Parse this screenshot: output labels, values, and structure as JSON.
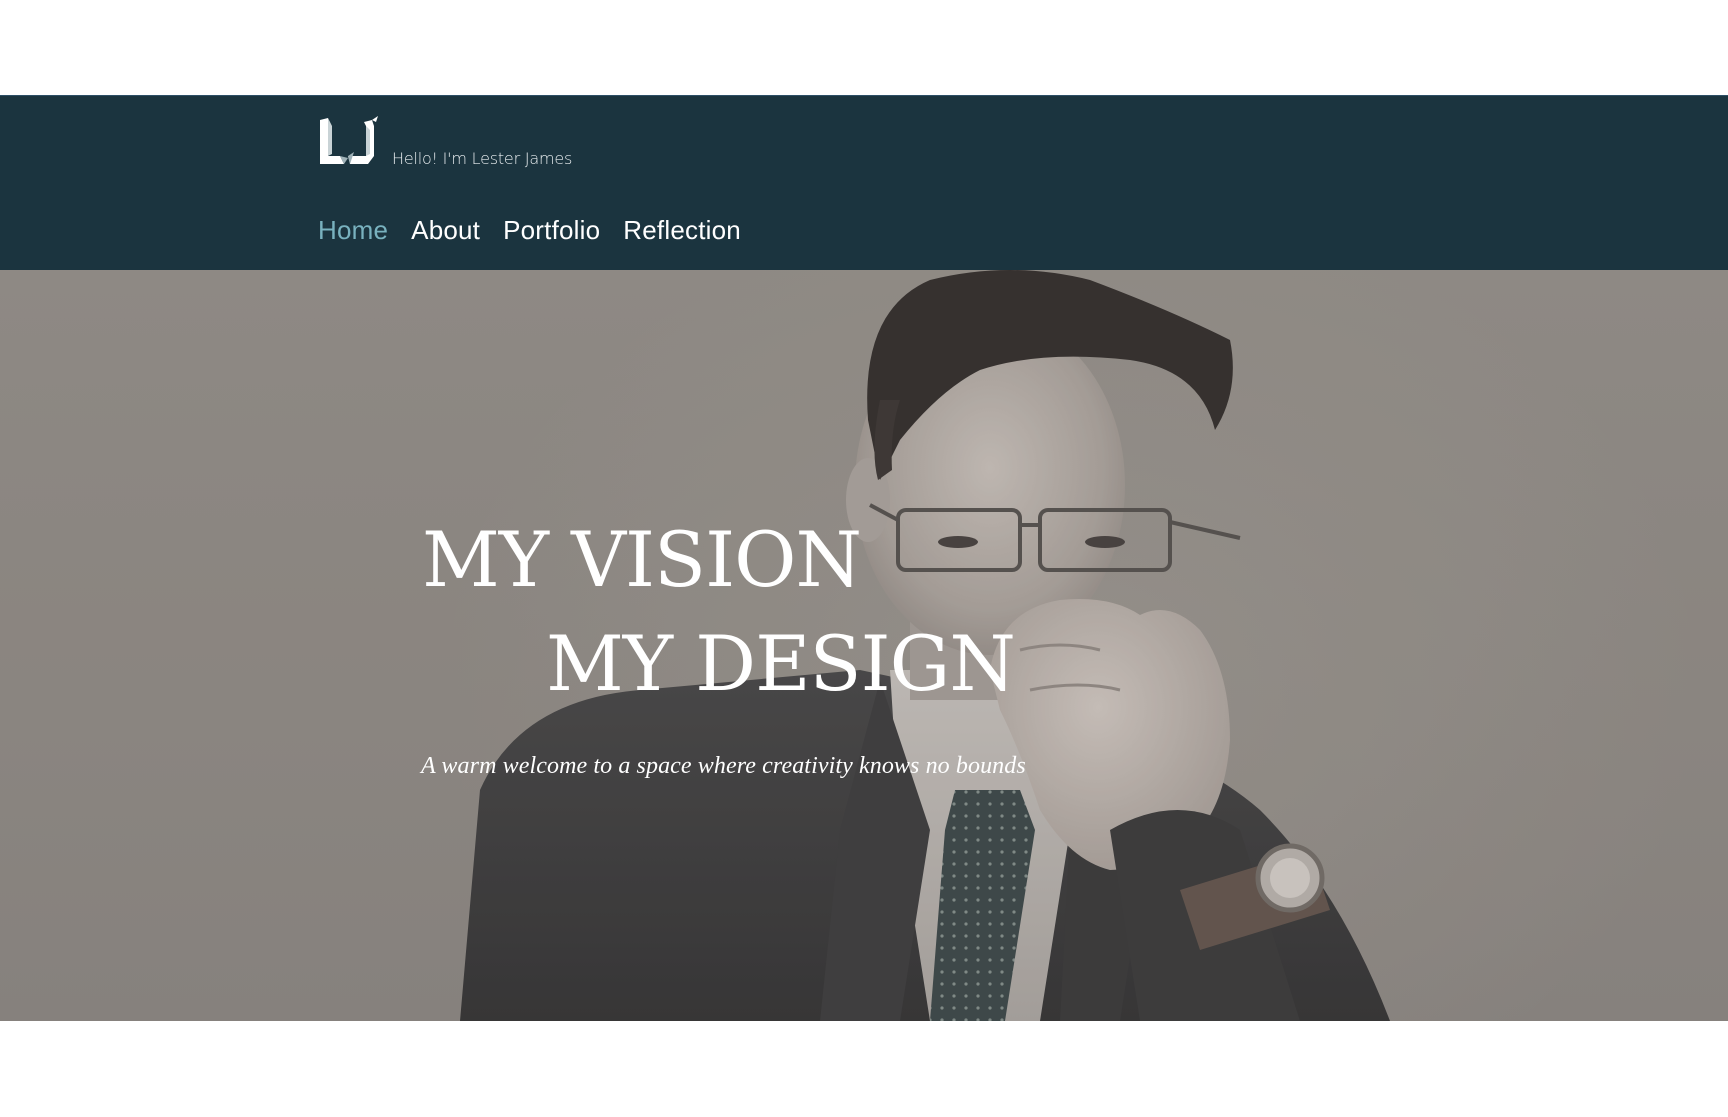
{
  "header": {
    "logo_icon": "lj-monogram-logo",
    "greeting": "Hello! I'm Lester James",
    "background_color": "#1b343f"
  },
  "nav": {
    "items": [
      {
        "label": "Home",
        "active": true
      },
      {
        "label": "About",
        "active": false
      },
      {
        "label": "Portfolio",
        "active": false
      },
      {
        "label": "Reflection",
        "active": false
      }
    ],
    "active_color": "#79b2bf"
  },
  "hero": {
    "line1": "MY VISION",
    "line2": "MY DESIGN",
    "tagline": "A warm welcome to a space where creativity knows no bounds"
  }
}
